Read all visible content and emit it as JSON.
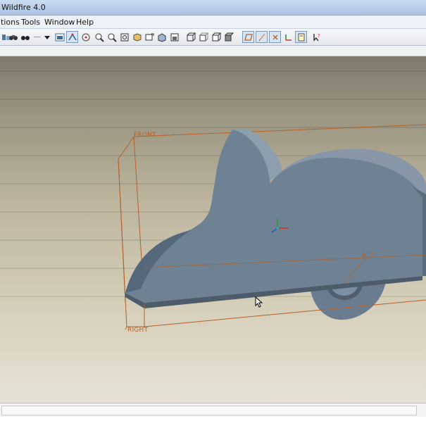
{
  "window": {
    "title": "Wildfire 4.0"
  },
  "menu": {
    "items": [
      "tions",
      "Tools",
      "Window",
      "Help"
    ]
  },
  "toolbar": {
    "buttons": [
      "toolbar-tool-icon",
      "binoculars-icon",
      "dropdown-arrow-icon",
      "display-style-icon",
      "datum-display-icon",
      "spin-center-icon",
      "zoom-in-icon",
      "zoom-out-icon",
      "refit-icon",
      "view-manager-icon",
      "saved-views-icon",
      "repaint-icon",
      "wireframe-icon",
      "hidden-line-icon",
      "no-hidden-icon",
      "shading-icon",
      "planes-toggle-icon",
      "axes-toggle-icon",
      "points-toggle-icon",
      "csys-toggle-icon",
      "annotation-toggle-icon",
      "whats-this-icon"
    ]
  },
  "viewport": {
    "datum_planes": {
      "front": "FRONT",
      "right": "RIGHT",
      "axis": "A_1"
    },
    "colors": {
      "plane": "#b4612a",
      "part": "#6e8294",
      "part_shadow": "#4c5c6b",
      "part_top": "#8d9eae"
    }
  }
}
